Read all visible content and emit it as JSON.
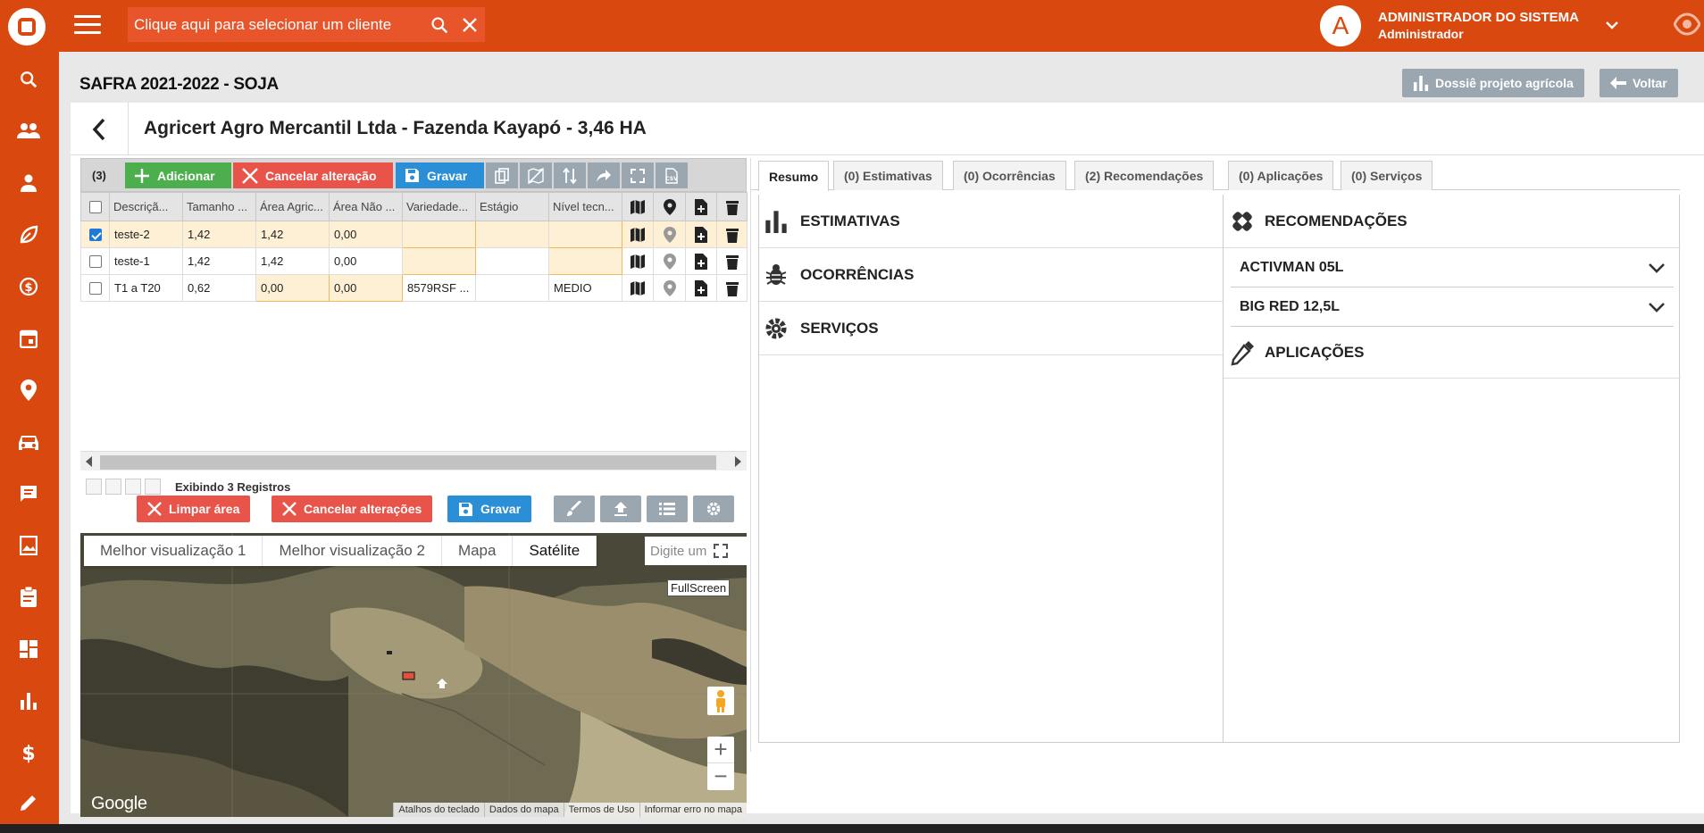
{
  "topbar": {
    "client_placeholder": "Clique aqui para selecionar um cliente",
    "user_name": "ADMINISTRADOR DO SISTEMA",
    "user_role": "Administrador",
    "avatar_letter": "A"
  },
  "sidebar": {
    "icons": [
      "search-icon",
      "users-icon",
      "person-icon",
      "leaf-icon",
      "money-cycle-icon",
      "calendar-icon",
      "location-pin-icon",
      "car-icon",
      "chat-icon",
      "photo-icon",
      "clipboard-icon",
      "dashboard-icon",
      "bar-chart-icon",
      "dollar-icon",
      "pencil-icon"
    ]
  },
  "page": {
    "title": "SAFRA 2021-2022 - SOJA",
    "dossie_label": "Dossiê projeto agrícola",
    "voltar_label": "Voltar",
    "farm_title": "Agricert Agro Mercantil Ltda - Fazenda Kayapó - 3,46 HA"
  },
  "grid": {
    "count": "(3)",
    "add_label": "Adicionar",
    "cancel_label": "Cancelar alteração",
    "save_label": "Gravar",
    "columns": [
      "Descriçã...",
      "Tamanho ...",
      "Área Agric...",
      "Área Não ...",
      "Variedade...",
      "Estágio",
      "Nível tecn..."
    ],
    "rows": [
      {
        "desc": "teste-2",
        "tam": "1,42",
        "agri": "1,42",
        "nao": "0,00",
        "var": "",
        "est": "",
        "niv": "",
        "checked": true
      },
      {
        "desc": "teste-1",
        "tam": "1,42",
        "agri": "1,42",
        "nao": "0,00",
        "var": "",
        "est": "",
        "niv": "",
        "checked": false
      },
      {
        "desc": "T1 a T20",
        "tam": "0,62",
        "agri": "0,00",
        "nao": "0,00",
        "var": "8579RSF ...",
        "est": "",
        "niv": "MEDIO",
        "checked": false
      }
    ],
    "footer": "Exibindo 3 Registros"
  },
  "maptools": {
    "clear_label": "Limpar área",
    "cancel_label": "Cancelar alterações",
    "save_label": "Gravar"
  },
  "map": {
    "types": [
      "Melhor visualização 1",
      "Melhor visualização 2",
      "Mapa",
      "Satélite"
    ],
    "active_type": "Satélite",
    "search_placeholder": "Digite um",
    "fullscreen_label": "FullScreen",
    "google": "Google",
    "footer": [
      "Atalhos do teclado",
      "Dados do mapa",
      "Termos de Uso",
      "Informar erro no mapa"
    ]
  },
  "tabs": [
    "Resumo",
    "(0) Estimativas",
    "(0) Ocorrências",
    "(2) Recomendações",
    "(0) Aplicações",
    "(0) Serviços"
  ],
  "summary": {
    "left": [
      "ESTIMATIVAS",
      "OCORRÊNCIAS",
      "SERVIÇOS"
    ],
    "recomendacoes_title": "RECOMENDAÇÕES",
    "recomendacoes": [
      "ACTIVMAN 05L",
      "BIG RED 12,5L"
    ],
    "aplicacoes_title": "APLICAÇÕES"
  },
  "colors": {
    "brand": "#d9480f",
    "green": "#4cae4c",
    "red": "#e8544a",
    "blue": "#2a8fd6",
    "gray": "#9aa7b0"
  }
}
